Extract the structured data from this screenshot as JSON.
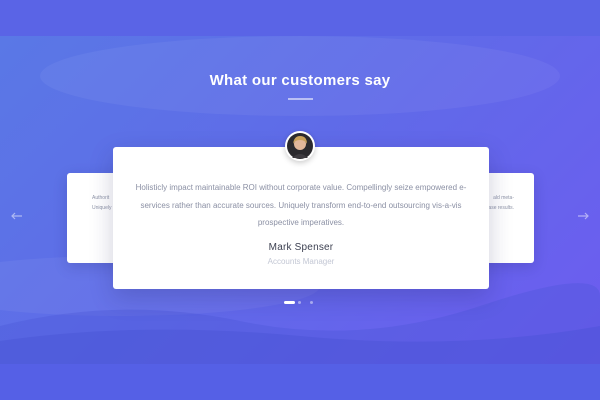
{
  "section": {
    "title": "What our customers say"
  },
  "testimonial": {
    "quote": "Holisticly impact maintainable ROI without corporate value. Compellingly seize empowered e-services rather than accurate sources. Uniquely transform end-to-end outsourcing vis-a-vis prospective imperatives.",
    "author": "Mark Spenser",
    "role": "Accounts Manager"
  },
  "side_cards": {
    "left_snippet_line1": "Authorit",
    "left_snippet_line2": "Uniquely c",
    "right_snippet_line1": "ald meta-",
    "right_snippet_line2": "ase results."
  },
  "carousel": {
    "active_slide": 1,
    "slide_count": 3,
    "prev_icon": "arrow-left-icon",
    "next_icon": "arrow-right-icon"
  },
  "colors": {
    "gradient_start": "#5a78e6",
    "gradient_end": "#6d5cf0",
    "card": "#ffffff",
    "author_text": "#3d4152",
    "body_text": "#8b90a4"
  }
}
